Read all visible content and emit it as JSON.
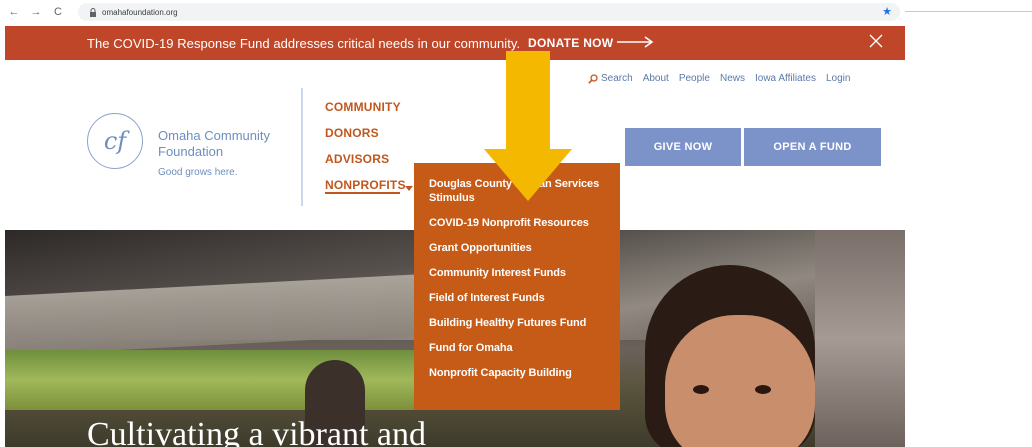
{
  "browser": {
    "url": "omahafoundation.org",
    "back_glyph": "←",
    "forward_glyph": "→",
    "reload_glyph": "C",
    "star_glyph": "★"
  },
  "banner": {
    "message": "The COVID-19 Response Fund addresses critical needs in our community.",
    "donate_label": "DONATE NOW",
    "color": "#c0462a"
  },
  "utility_nav": {
    "search_label": "Search",
    "items": [
      "About",
      "People",
      "News",
      "Iowa Affiliates",
      "Login"
    ]
  },
  "logo": {
    "monogram": "cf",
    "name": "Omaha Community Foundation",
    "tagline": "Good grows here."
  },
  "main_nav": {
    "items": [
      "COMMUNITY",
      "DONORS",
      "ADVISORS",
      "NONPROFITS"
    ],
    "active": "NONPROFITS",
    "color": "#c0571f"
  },
  "buttons": {
    "give_now": "GIVE NOW",
    "open_fund": "OPEN A FUND",
    "color": "#7b93c9"
  },
  "dropdown": {
    "color": "#c65a17",
    "items": [
      "Douglas County Human Services Stimulus",
      "COVID-19 Nonprofit Resources",
      "Grant Opportunities",
      "Community Interest Funds",
      "Field of Interest Funds",
      "Building Healthy Futures Fund",
      "Fund for Omaha",
      "Nonprofit Capacity Building"
    ]
  },
  "hero": {
    "headline": "Cultivating a vibrant and"
  },
  "annotation": {
    "arrow_color": "#f5b800"
  }
}
